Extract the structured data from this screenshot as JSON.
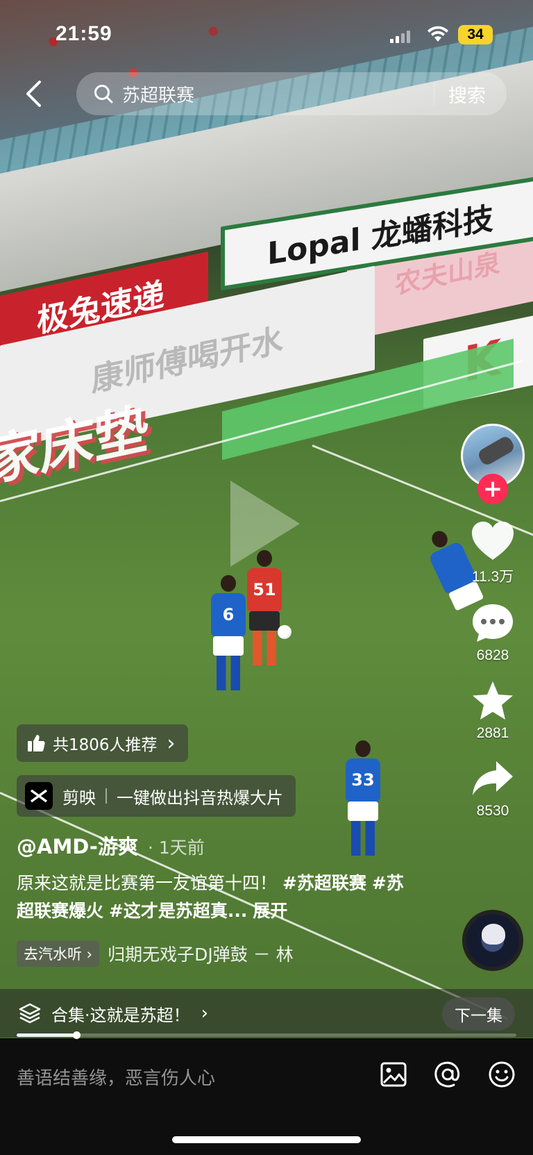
{
  "status_bar": {
    "time": "21:59",
    "battery": "34"
  },
  "search": {
    "query": "苏超联赛",
    "button_label": "搜索"
  },
  "video_text": {
    "board_lopal": "Lopal 龙蟠科技",
    "board_red": "极兔速递",
    "board_white": "康师傅喝开水",
    "board_pink": "农夫山泉",
    "board_k": "K",
    "turf_ad": "家床垫",
    "jersey_1": "6",
    "jersey_2": "51",
    "jersey_3": "33"
  },
  "rail": {
    "follow_label": "+",
    "like_count": "11.3万",
    "comment_count": "6828",
    "favorite_count": "2881",
    "share_count": "8530"
  },
  "recommend": {
    "label": "共1806人推荐",
    "chevron": "›"
  },
  "capcut": {
    "app_name": "剪映",
    "slogan": "一键做出抖音热爆大片"
  },
  "post": {
    "author": "@AMD-游爽",
    "dot": "·",
    "time": "1天前",
    "caption_text": "原来这就是比赛第一友谊第十四！",
    "tag1": "#苏超联赛",
    "tag2": "#苏超联赛爆火",
    "tag3": "#这才是苏超真...",
    "expand": "展开"
  },
  "music": {
    "chip_label": "去汽水听 ›",
    "title": "归期无戏子DJ弹鼓 － 林"
  },
  "collection": {
    "label": "合集·这就是苏超！",
    "chevron": "›",
    "next_label": "下一集"
  },
  "playback": {
    "progress_fraction": 0.12
  },
  "comment": {
    "placeholder": "善语结善缘，恶言伤人心"
  },
  "colors": {
    "accent_red": "#fe2c55",
    "battery_yellow": "#f6d32d"
  }
}
